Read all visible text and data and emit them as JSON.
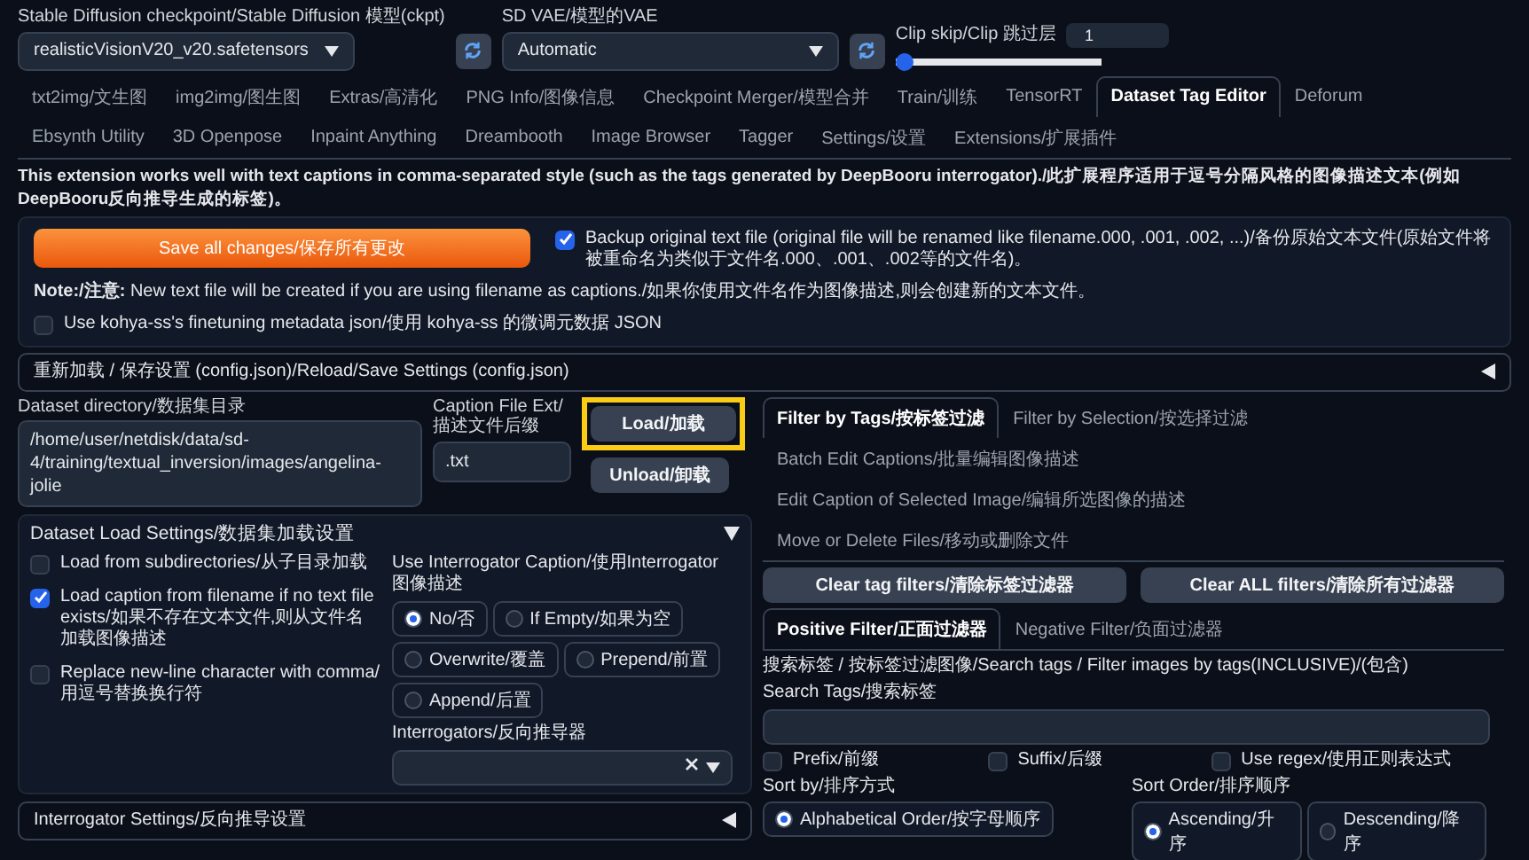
{
  "top_settings": {
    "checkpoint": {
      "label": "Stable Diffusion checkpoint/Stable Diffusion 模型(ckpt)",
      "value": "realisticVisionV20_v20.safetensors"
    },
    "vae": {
      "label": "SD VAE/模型的VAE",
      "value": "Automatic"
    },
    "clip_skip": {
      "label": "Clip skip/Clip 跳过层",
      "value": "1",
      "level": 0
    }
  },
  "tabs": [
    {
      "label": "txt2img/文生图",
      "selected": false
    },
    {
      "label": "img2img/图生图",
      "selected": false
    },
    {
      "label": "Extras/高清化",
      "selected": false
    },
    {
      "label": "PNG Info/图像信息",
      "selected": false
    },
    {
      "label": "Checkpoint Merger/模型合并",
      "selected": false
    },
    {
      "label": "Train/训练",
      "selected": false
    },
    {
      "label": "TensorRT",
      "selected": false
    },
    {
      "label": "Dataset Tag Editor",
      "selected": true
    },
    {
      "label": "Deforum",
      "selected": false
    },
    {
      "label": "Ebsynth Utility",
      "selected": false
    },
    {
      "label": "3D Openpose",
      "selected": false
    },
    {
      "label": "Inpaint Anything",
      "selected": false
    },
    {
      "label": "Dreambooth",
      "selected": false
    },
    {
      "label": "Image Browser",
      "selected": false
    },
    {
      "label": "Tagger",
      "selected": false
    },
    {
      "label": "Settings/设置",
      "selected": false
    },
    {
      "label": "Extensions/扩展插件",
      "selected": false
    }
  ],
  "intro": "This extension works well with text captions in comma-separated style (such as the tags generated by DeepBooru interrogator)./此扩展程序适用于逗号分隔风格的图像描述文本(例如DeepBooru反向推导生成的标签)。",
  "save_button": "Save all changes/保存所有更改",
  "backup": {
    "label": "Backup original text file (original file will be renamed like filename.000, .001, .002, ...)/备份原始文本文件(原始文件将被重命名为类似于文件名.000、.001、.002等的文件名)。",
    "checked": true
  },
  "note": "**Note:/注意:** New text file will be created if you are using filename as captions./如果你使用文件名作为图像描述,则会创建新的文本文件。",
  "kohya": {
    "label": "Use kohya-ss's finetuning metadata json/使用 kohya-ss 的微调元数据 JSON",
    "checked": false
  },
  "reload_section": {
    "title": "重新加载 / 保存设置 (config.json)/Reload/Save Settings (config.json)",
    "expanded": false
  },
  "dataset": {
    "directory": {
      "label": "Dataset directory/数据集目录",
      "value": "/home/user/netdisk/data/sd-4/training/textual_inversion/images/angelina-jolie"
    },
    "caption_ext": {
      "label": "Caption File Ext/描述文件后缀",
      "value": ".txt"
    },
    "load_button": "Load/加载",
    "unload_button": "Unload/卸载"
  },
  "load_settings": {
    "title": "Dataset Load Settings/数据集加载设置",
    "expanded": true,
    "checkboxes": [
      {
        "label": "Load from subdirectories/从子目录加载",
        "checked": false
      },
      {
        "label": "Load caption from filename if no text file exists/如果不存在文本文件,则从文件名加载图像描述",
        "checked": true
      },
      {
        "label": "Replace new-line character with comma/用逗号替换换行符",
        "checked": false
      }
    ],
    "interrogator_caption": {
      "label": "Use Interrogator Caption/使用Interrogator图像描述",
      "options": [
        {
          "label": "No/否",
          "selected": true
        },
        {
          "label": "If Empty/如果为空",
          "selected": false
        },
        {
          "label": "Overwrite/覆盖",
          "selected": false
        },
        {
          "label": "Prepend/前置",
          "selected": false
        },
        {
          "label": "Append/后置",
          "selected": false
        }
      ]
    },
    "interrogators": {
      "label": "Interrogators/反向推导器"
    }
  },
  "interrogator_settings": {
    "title": "Interrogator Settings/反向推导设置",
    "expanded": false
  },
  "filter_tabs": [
    {
      "label": "Filter by Tags/按标签过滤",
      "selected": true
    },
    {
      "label": "Filter by Selection/按选择过滤",
      "selected": false
    },
    {
      "label": "Batch Edit Captions/批量编辑图像描述",
      "selected": false
    },
    {
      "label": "Edit Caption of Selected Image/编辑所选图像的描述",
      "selected": false
    },
    {
      "label": "Move or Delete Files/移动或删除文件",
      "selected": false
    }
  ],
  "clear_buttons": [
    "Clear tag filters/清除标签过滤器",
    "Clear ALL filters/清除所有过滤器"
  ],
  "filter_subtabs": [
    {
      "label": "Positive Filter/正面过滤器",
      "selected": true
    },
    {
      "label": "Negative Filter/负面过滤器",
      "selected": false
    }
  ],
  "search_heading": "搜索标签 / 按标签过滤图像/Search tags / Filter images by tags(INCLUSIVE)/(包含)",
  "search_tags": {
    "label": "Search Tags/搜索标签"
  },
  "options": [
    {
      "label": "Prefix/前缀",
      "checked": false
    },
    {
      "label": "Suffix/后缀",
      "checked": false
    },
    {
      "label": "Use regex/使用正则表达式",
      "checked": false
    }
  ],
  "sort_by": {
    "label": "Sort by/排序方式",
    "options": [
      {
        "label": "Alphabetical Order/按字母顺序",
        "selected": true
      }
    ]
  },
  "sort_order": {
    "label": "Sort Order/排序顺序",
    "options": [
      {
        "label": "Ascending/升序",
        "selected": true
      },
      {
        "label": "Descending/降序",
        "selected": false
      }
    ]
  }
}
